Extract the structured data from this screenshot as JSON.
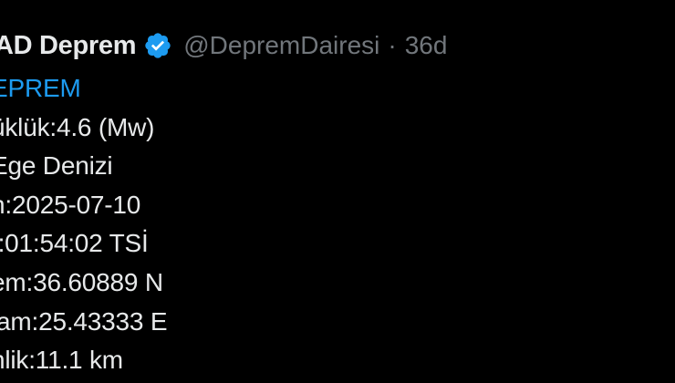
{
  "tweet": {
    "display_name": "AD Deprem",
    "verified_icon": "verified-badge-icon",
    "handle": "@DepremDairesi",
    "separator": "·",
    "time": "36d",
    "accent_color": "#1d9bf0",
    "lines": [
      "EPREM",
      "üklük:4.6 (Mw)",
      "Ege Denizi",
      "h:2025-07-10",
      "t:01:54:02 TSİ",
      "em:36.60889 N",
      "lam:25.43333 E",
      "nlik:11.1 km"
    ]
  }
}
